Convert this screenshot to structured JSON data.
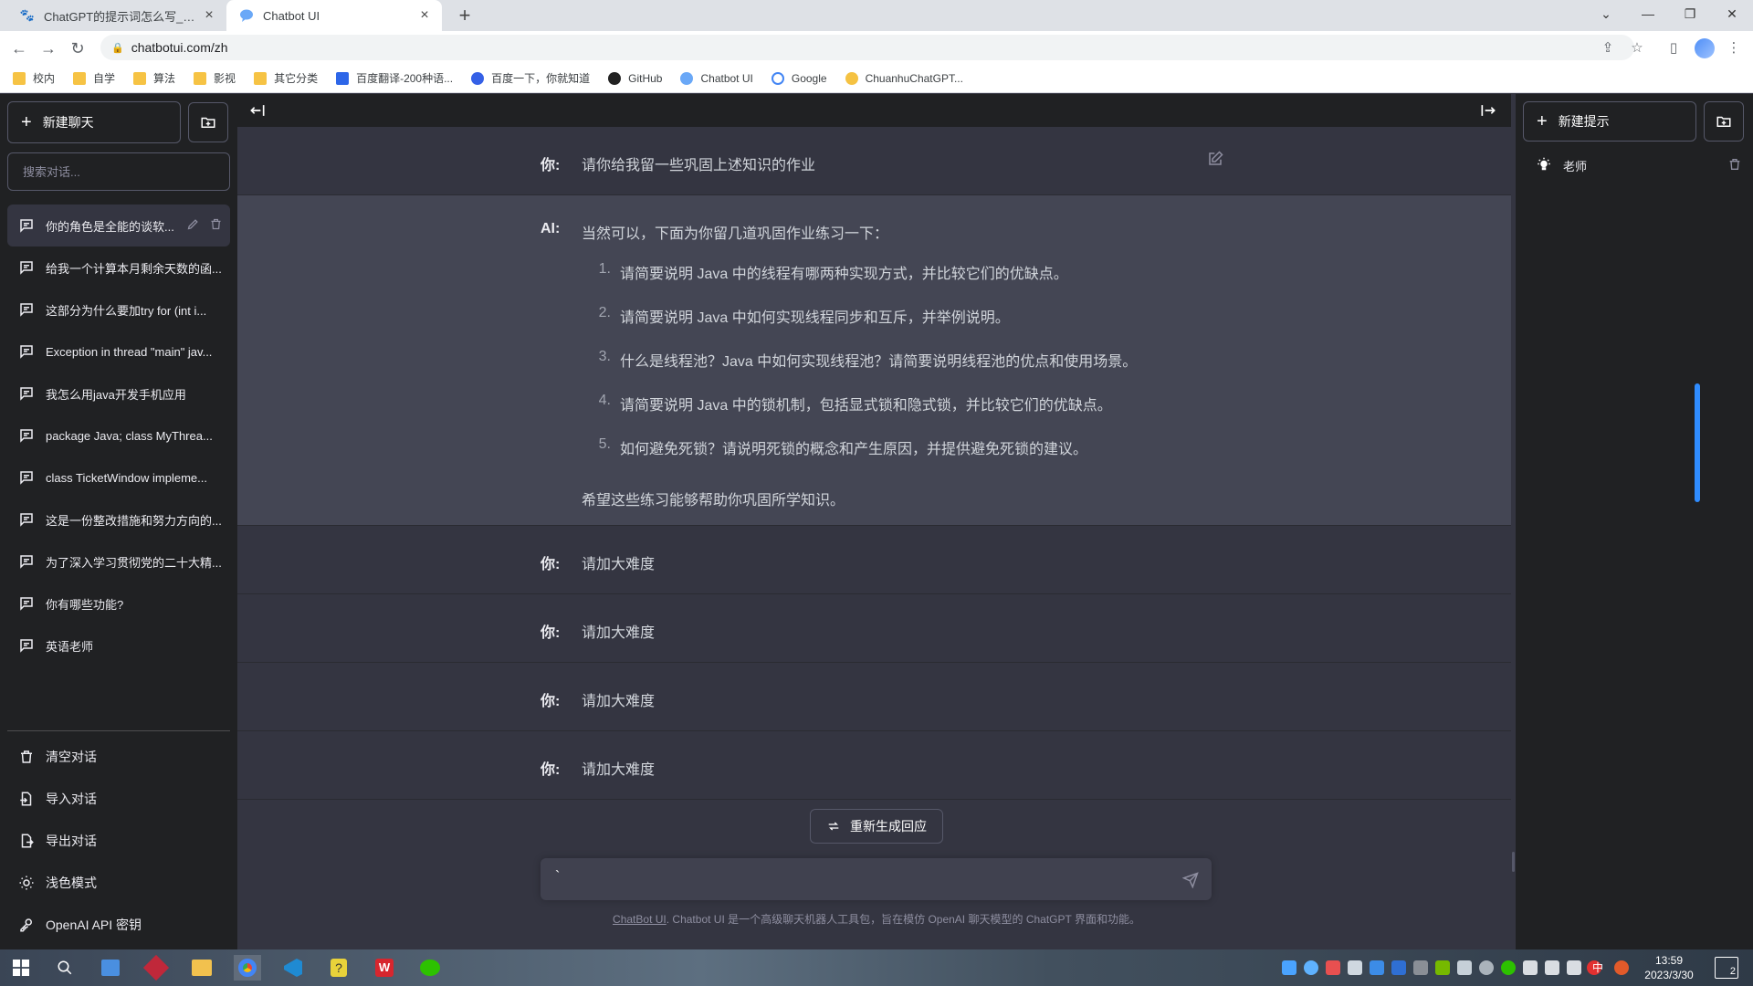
{
  "browser": {
    "tabs": [
      {
        "title": "ChatGPT的提示词怎么写_百度搜",
        "active": false
      },
      {
        "title": "Chatbot UI",
        "active": true
      }
    ],
    "url": "chatbotui.com/zh",
    "bookmarks": [
      "校内",
      "自学",
      "算法",
      "影视",
      "其它分类",
      "百度翻译-200种语...",
      "百度一下，你就知道",
      "GitHub",
      "Chatbot UI",
      "Google",
      "ChuanhuChatGPT..."
    ]
  },
  "sidebar": {
    "new_chat_label": "新建聊天",
    "search_placeholder": "搜索对话...",
    "conversations": [
      "你的角色是全能的谈软...",
      "给我一个计算本月剩余天数的函...",
      "这部分为什么要加try for (int i...",
      "Exception in thread \"main\" jav...",
      "我怎么用java开发手机应用",
      "package Java; class MyThrea...",
      "class TicketWindow impleme...",
      "这是一份整改措施和努力方向的...",
      "为了深入学习贯彻党的二十大精...",
      "你有哪些功能?",
      "英语老师"
    ],
    "bottom": {
      "clear": "清空对话",
      "import": "导入对话",
      "export": "导出对话",
      "theme": "浅色模式",
      "apikey": "OpenAI API 密钥"
    }
  },
  "chat": {
    "messages": [
      {
        "role": "你:",
        "text": "请你给我留一些巩固上述知识的作业"
      },
      {
        "role": "AI:",
        "intro": "当然可以，下面为你留几道巩固作业练习一下：",
        "items": [
          "请简要说明 Java 中的线程有哪两种实现方式，并比较它们的优缺点。",
          "请简要说明 Java 中如何实现线程同步和互斥，并举例说明。",
          "什么是线程池？Java 中如何实现线程池？请简要说明线程池的优点和使用场景。",
          "请简要说明 Java 中的锁机制，包括显式锁和隐式锁，并比较它们的优缺点。",
          "如何避免死锁？请说明死锁的概念和产生原因，并提供避免死锁的建议。"
        ],
        "outro": "希望这些练习能够帮助你巩固所学知识。"
      },
      {
        "role": "你:",
        "text": "请加大难度"
      },
      {
        "role": "你:",
        "text": "请加大难度"
      },
      {
        "role": "你:",
        "text": "请加大难度"
      },
      {
        "role": "你:",
        "text": "请加大难度"
      }
    ],
    "regenerate_label": "重新生成回应",
    "input_value": "`",
    "footer_link": "ChatBot UI",
    "footer_text": ". Chatbot UI 是一个高级聊天机器人工具包，旨在模仿 OpenAI 聊天模型的 ChatGPT 界面和功能。"
  },
  "prompts": {
    "new_prompt_label": "新建提示",
    "items": [
      "老师"
    ]
  },
  "taskbar": {
    "time": "13:59",
    "date": "2023/3/30",
    "ime": "中",
    "notifications": "2"
  },
  "colors": {
    "sidebar_bg": "#202123",
    "main_bg": "#343541",
    "ai_bg": "#444654",
    "accent_blue": "#2f8cff"
  }
}
